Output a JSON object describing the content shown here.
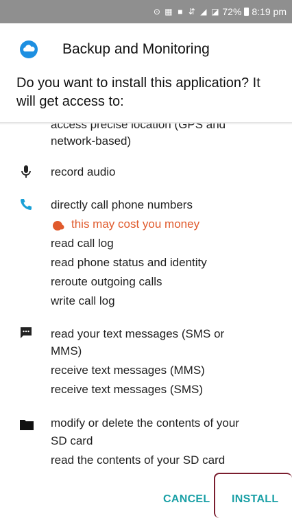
{
  "status_bar": {
    "battery": "72%",
    "time": "8:19 pm"
  },
  "dialog": {
    "title": "Backup and Monitoring",
    "prompt": "Do you want to install this application? It will get access to:"
  },
  "permissions": {
    "location": [
      "access precise location (GPS and",
      "network-based)"
    ],
    "microphone": [
      "record audio"
    ],
    "phone": {
      "items": [
        "directly call phone numbers"
      ],
      "warning": "this may cost you money",
      "more": [
        "read call log",
        "read phone status and identity",
        "reroute outgoing calls",
        "write call log"
      ]
    },
    "sms": [
      "read your text messages (SMS or",
      "MMS)",
      "receive text messages (MMS)",
      "receive text messages (SMS)"
    ],
    "storage": [
      "modify or delete the contents of your",
      "SD card",
      "read the contents of your SD card"
    ]
  },
  "buttons": {
    "cancel": "CANCEL",
    "install": "INSTALL"
  },
  "colors": {
    "accent": "#1aa0a6",
    "warning": "#e05a2c",
    "status_bar": "#8f8f8f",
    "highlight_outline": "#7a1d2e"
  }
}
